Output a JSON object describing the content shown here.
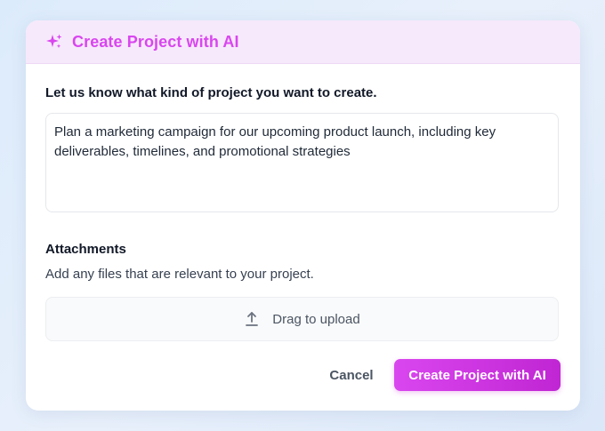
{
  "dialog": {
    "title": "Create Project with AI",
    "accent_color": "#d946ef"
  },
  "prompt": {
    "label": "Let us know what kind of project you want to create.",
    "value": "Plan a marketing campaign for our upcoming product launch, including key deliverables, timelines, and promotional strategies"
  },
  "attachments": {
    "title": "Attachments",
    "description": "Add any files that are relevant to your project.",
    "upload_label": "Drag to upload",
    "upload_icon": "upload-icon"
  },
  "actions": {
    "cancel_label": "Cancel",
    "create_label": "Create Project with AI"
  }
}
